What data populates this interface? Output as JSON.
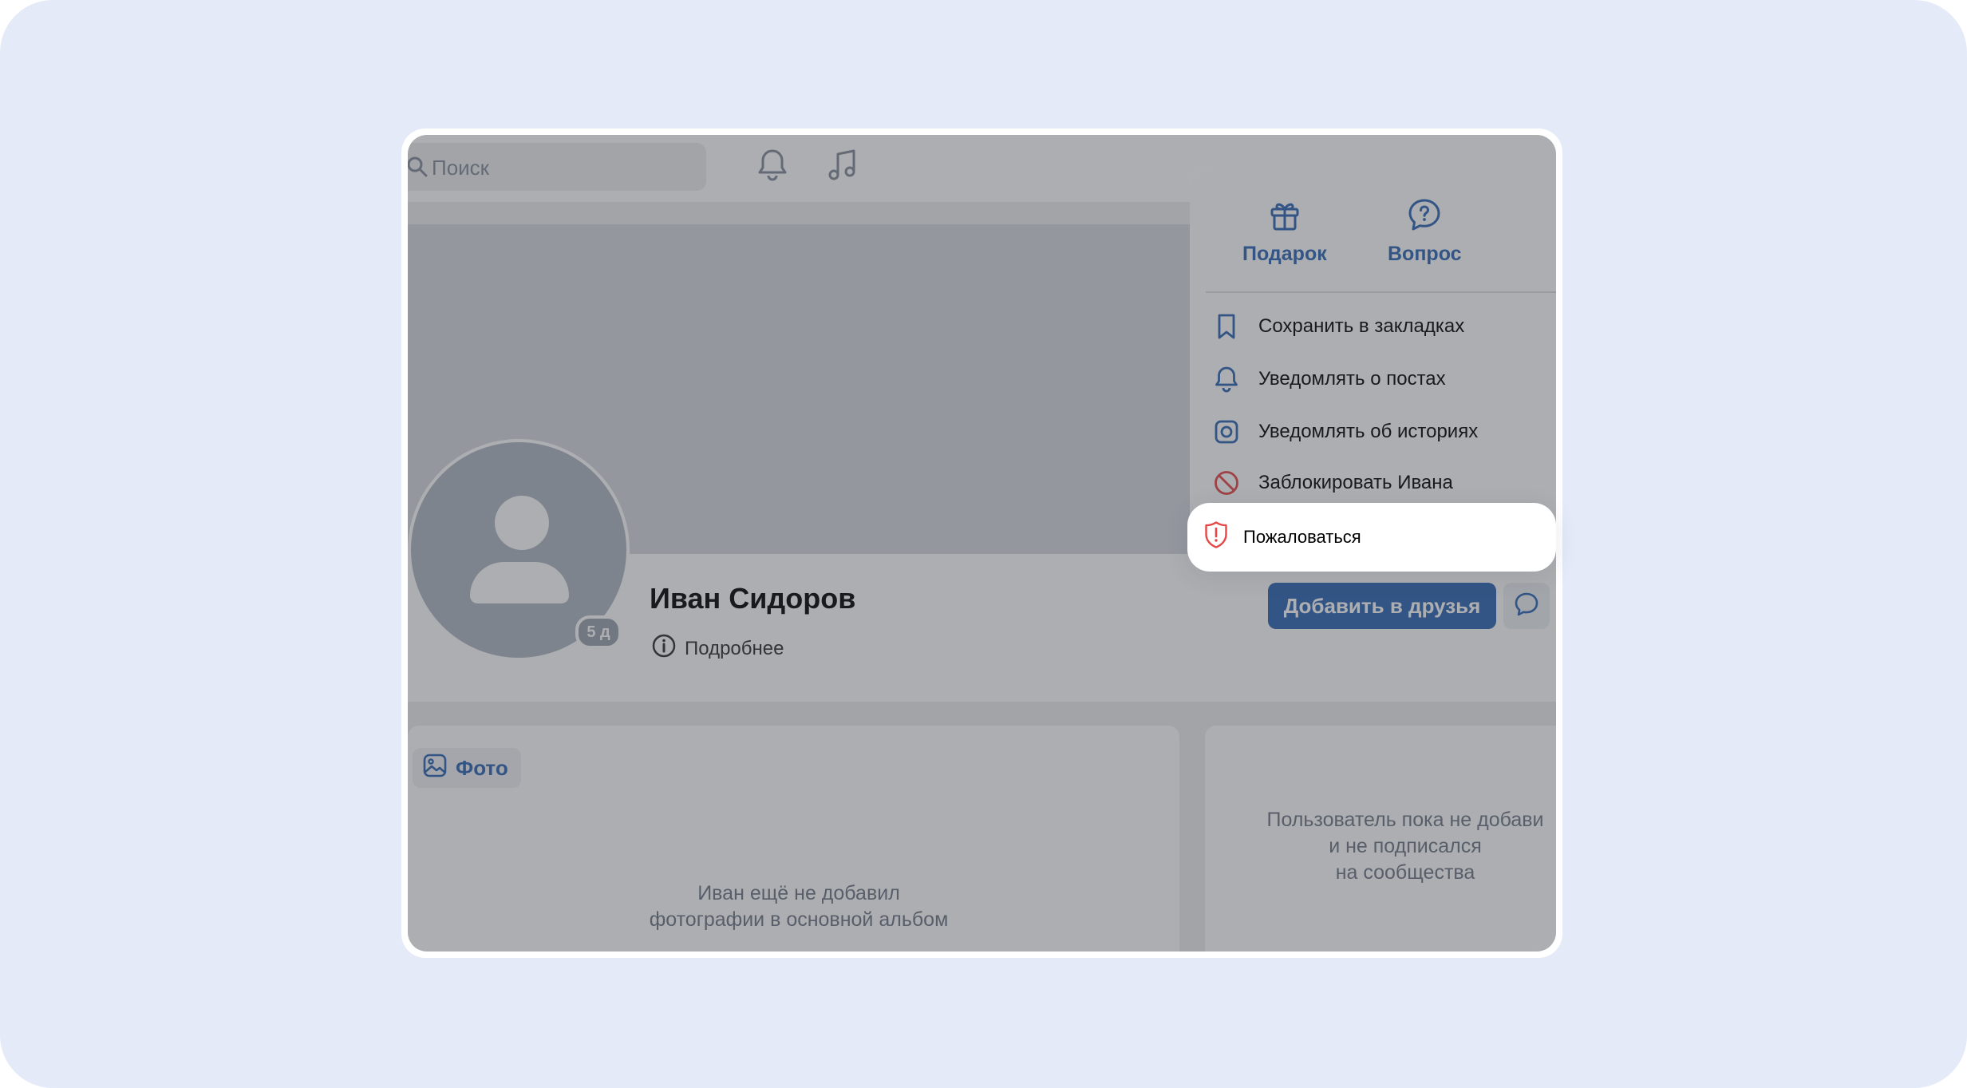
{
  "topbar": {
    "search_placeholder": "Поиск",
    "icons": [
      "search-icon",
      "bell-icon",
      "music-icon"
    ]
  },
  "profile": {
    "name": "Иван Сидоров",
    "details_label": "Подробнее",
    "online_badge": "5 д",
    "add_friend_label": "Добавить в друзья"
  },
  "menu": {
    "quick_actions": [
      {
        "label": "Подарок",
        "icon": "gift-icon"
      },
      {
        "label": "Вопрос",
        "icon": "question-bubble-icon"
      }
    ],
    "items": [
      {
        "label": "Сохранить в закладках",
        "icon": "bookmark-icon"
      },
      {
        "label": "Уведомлять о постах",
        "icon": "bell-icon"
      },
      {
        "label": "Уведомлять об историях",
        "icon": "story-icon"
      },
      {
        "label": "Заблокировать Ивана",
        "icon": "block-icon"
      }
    ],
    "highlighted_item": {
      "label": "Пожаловаться",
      "icon": "report-icon"
    }
  },
  "photos": {
    "tab_label": "Фото",
    "empty_line1": "Иван ещё не добавил",
    "empty_line2": "фотографии в основной альбом"
  },
  "subscriptions": {
    "empty_line1": "Пользователь пока не добави",
    "empty_line2": "и не подписался",
    "empty_line3": "на сообщества"
  },
  "colors": {
    "background": "#e4eaf7",
    "accent": "#2e67b3",
    "danger": "#e64646"
  }
}
